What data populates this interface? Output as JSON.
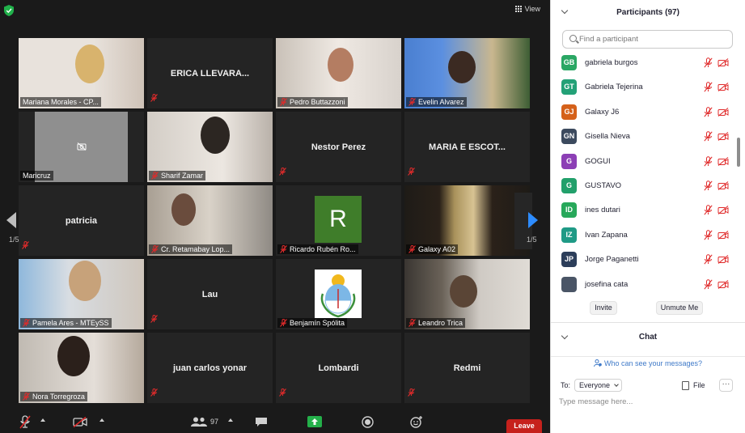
{
  "window": {
    "view_label": "View"
  },
  "tiles": [
    {
      "name": "Mariana Morales - CP...",
      "kind": "video"
    },
    {
      "name": "ERICA LLEVARA...",
      "kind": "name"
    },
    {
      "name": "Pedro Buttazzoni",
      "kind": "video"
    },
    {
      "name": "Evelin Alvarez",
      "kind": "video"
    },
    {
      "name": "Maricruz",
      "kind": "camoff"
    },
    {
      "name": "Sharif Zamar",
      "kind": "video"
    },
    {
      "name": "Nestor Perez",
      "kind": "name"
    },
    {
      "name": "MARIA E ESCOT...",
      "kind": "name"
    },
    {
      "name": "patricia",
      "kind": "name"
    },
    {
      "name": "Cr. Retamabay Lop...",
      "kind": "video"
    },
    {
      "name": "Ricardo Rubén Ro...",
      "kind": "avatar",
      "initial": "R",
      "color": "#3f7d2a"
    },
    {
      "name": "Galaxy A02",
      "kind": "video"
    },
    {
      "name": "Pamela Ares - MTEySS",
      "kind": "video",
      "active": true
    },
    {
      "name": "Lau",
      "kind": "name"
    },
    {
      "name": "Benjamín Spólita",
      "kind": "crest"
    },
    {
      "name": "Leandro Trica",
      "kind": "video"
    },
    {
      "name": "Nora Torregroza",
      "kind": "video"
    },
    {
      "name": "juan carlos yonar",
      "kind": "name"
    },
    {
      "name": "Lombardi",
      "kind": "name"
    },
    {
      "name": "Redmi",
      "kind": "name"
    }
  ],
  "pager": {
    "left": "1/5",
    "right": "1/5"
  },
  "toolbar": {
    "participants_count": "97",
    "leave_label": "Leave"
  },
  "colors": {
    "muted_red": "#e02b2b",
    "active_speaker": "#d8e63c",
    "leave": "#c6211c",
    "next_arrow": "#2d8cff"
  },
  "panel": {
    "title": "Participants (97)",
    "search_placeholder": "Find a participant",
    "participants": [
      {
        "initials": "GB",
        "name": "gabriela burgos",
        "color": "#2aa764"
      },
      {
        "initials": "GT",
        "name": "Gabriela Tejerina",
        "color": "#23a177"
      },
      {
        "initials": "GJ",
        "name": "Galaxy J6",
        "color": "#d5611a"
      },
      {
        "initials": "GN",
        "name": "Gisella Nieva",
        "color": "#3c4a5e"
      },
      {
        "initials": "G",
        "name": "GOGUI",
        "color": "#8c3fb5"
      },
      {
        "initials": "G",
        "name": "GUSTAVO",
        "color": "#22a06b"
      },
      {
        "initials": "ID",
        "name": "ines dutari",
        "color": "#27a85a"
      },
      {
        "initials": "IZ",
        "name": "Ivan Zapana",
        "color": "#1f9a86"
      },
      {
        "initials": "JP",
        "name": "Jorge Paganetti",
        "color": "#2c3e5a"
      },
      {
        "initials": "",
        "name": "josefina cata",
        "color": "#4a5566"
      }
    ],
    "invite_label": "Invite",
    "unmute_label": "Unmute Me"
  },
  "chat": {
    "title": "Chat",
    "who_can_see": "Who can see your messages?",
    "to_label": "To:",
    "recipient": "Everyone",
    "file_label": "File",
    "more_label": "···",
    "message_placeholder": "Type message here..."
  }
}
